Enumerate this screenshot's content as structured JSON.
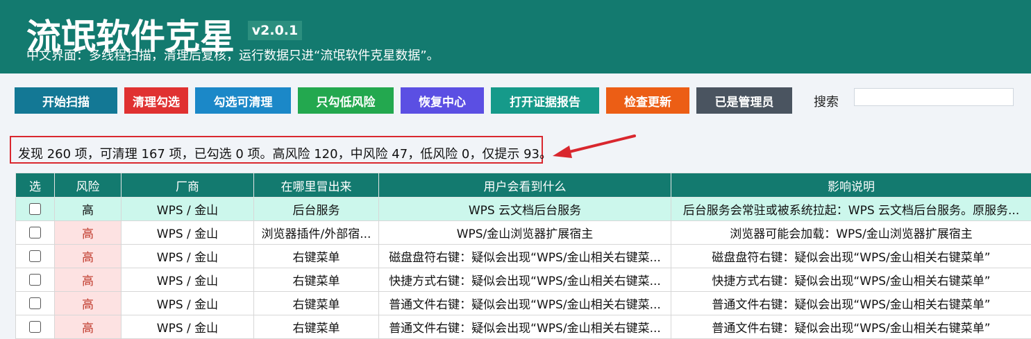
{
  "header": {
    "title": "流氓软件克星",
    "version": "v2.0.1",
    "subtitle": "中文界面：多线程扫描，清理后复核，运行数据只进“流氓软件克星数据”。"
  },
  "toolbar": {
    "buttons": [
      {
        "label": "开始扫描",
        "color": "#137895"
      },
      {
        "label": "清理勾选",
        "color": "#e03131"
      },
      {
        "label": "勾选可清理",
        "color": "#1b88c8"
      },
      {
        "label": "只勾低风险",
        "color": "#23a84f"
      },
      {
        "label": "恢复中心",
        "color": "#5b4fe3"
      },
      {
        "label": "打开证据报告",
        "color": "#169a8a"
      },
      {
        "label": "检查更新",
        "color": "#ec5e15"
      },
      {
        "label": "已是管理员",
        "color": "#4a5460"
      }
    ],
    "search_label": "搜索",
    "search_value": ""
  },
  "summary": "发现 260 项，可清理 167 项，已勾选 0 项。高风险 120，中风险 47，低风险 0，仅提示 93。",
  "table": {
    "headers": [
      "选",
      "风险",
      "厂商",
      "在哪里冒出来",
      "用户会看到什么",
      "影响说明"
    ],
    "rows": [
      {
        "checked": false,
        "risk": "高",
        "vendor": "WPS / 金山",
        "where": "后台服务",
        "sees": "WPS 云文档后台服务",
        "impact": "后台服务会常驻或被系统拉起：WPS 云文档后台服务。原服务..."
      },
      {
        "checked": false,
        "risk": "高",
        "vendor": "WPS / 金山",
        "where": "浏览器插件/外部宿...",
        "sees": "WPS/金山浏览器扩展宿主",
        "impact": "浏览器可能会加载：WPS/金山浏览器扩展宿主"
      },
      {
        "checked": false,
        "risk": "高",
        "vendor": "WPS / 金山",
        "where": "右键菜单",
        "sees": "磁盘盘符右键：疑似会出现“WPS/金山相关右键菜...",
        "impact": "磁盘盘符右键：疑似会出现“WPS/金山相关右键菜单”"
      },
      {
        "checked": false,
        "risk": "高",
        "vendor": "WPS / 金山",
        "where": "右键菜单",
        "sees": "快捷方式右键：疑似会出现“WPS/金山相关右键菜...",
        "impact": "快捷方式右键：疑似会出现“WPS/金山相关右键菜单”"
      },
      {
        "checked": false,
        "risk": "高",
        "vendor": "WPS / 金山",
        "where": "右键菜单",
        "sees": "普通文件右键：疑似会出现“WPS/金山相关右键菜...",
        "impact": "普通文件右键：疑似会出现“WPS/金山相关右键菜单”"
      },
      {
        "checked": false,
        "risk": "高",
        "vendor": "WPS / 金山",
        "where": "右键菜单",
        "sees": "普通文件右键：疑似会出现“WPS/金山相关右键菜...",
        "impact": "普通文件右键：疑似会出现“WPS/金山相关右键菜单”"
      }
    ]
  },
  "colors": {
    "header_bg": "#137a6f",
    "high_risk_bg": "#fde2e2",
    "high_risk_text": "#c0392b",
    "highlight_row": "#ccf7ec",
    "annotation_red": "#d9272e"
  }
}
